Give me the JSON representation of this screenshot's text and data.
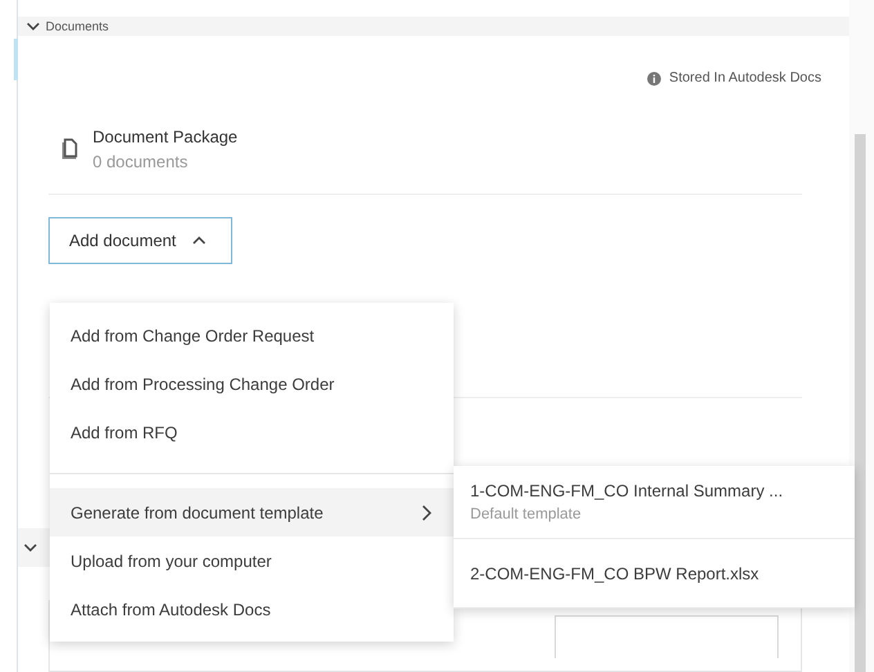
{
  "section": {
    "title": "Documents",
    "expanded": true
  },
  "storage_note": "Stored In Autodesk Docs",
  "package": {
    "title": "Document Package",
    "count": "0 documents"
  },
  "add_button": {
    "label": "Add document",
    "expanded": true
  },
  "menu": [
    {
      "kind": "option",
      "label": "Add from Change Order Request",
      "selected": false
    },
    {
      "kind": "option",
      "label": "Add from Processing Change Order",
      "selected": false
    },
    {
      "kind": "option",
      "label": "Add from RFQ",
      "selected": false
    },
    {
      "kind": "divider"
    },
    {
      "kind": "submenu",
      "label": "Generate from document template",
      "selected": true
    },
    {
      "kind": "option",
      "label": "Upload from your computer",
      "selected": false
    },
    {
      "kind": "option",
      "label": "Attach from Autodesk Docs",
      "selected": false
    }
  ],
  "submenu": [
    {
      "label": "1-COM-ENG-FM_CO Internal Summary ...",
      "note": "Default template"
    },
    {
      "label": "2-COM-ENG-FM_CO BPW Report.xlsx"
    }
  ],
  "next_section": {
    "expanded": true
  }
}
